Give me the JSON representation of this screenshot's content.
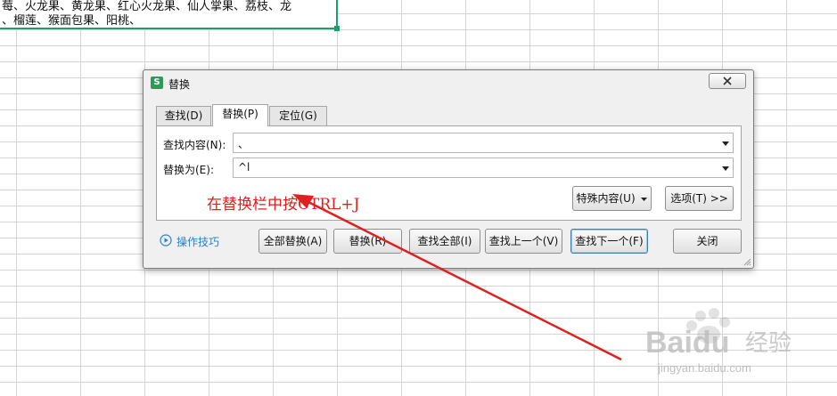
{
  "sheet": {
    "cell_lines": [
      "莓、火龙果、黄龙果、红心火龙果、仙人掌果、荔枝、龙",
      "、榴莲、猴面包果、阳桃、"
    ]
  },
  "dialog": {
    "title": "替换",
    "app_icon": "S",
    "tabs": [
      {
        "label": "查找(D)"
      },
      {
        "label": "替换(P)",
        "active": true
      },
      {
        "label": "定位(G)"
      }
    ],
    "find_label": "查找内容(N):",
    "find_value": "、",
    "replace_label": "替换为(E):",
    "replace_value": "^l",
    "special_button": "特殊内容(U)",
    "options_button": "选项(T) >>",
    "tips_link": "操作技巧",
    "buttons": {
      "replace_all": "全部替换(A)",
      "replace": "替换(R)",
      "find_all": "查找全部(I)",
      "find_prev": "查找上一个(V)",
      "find_next": "查找下一个(F)",
      "close": "关闭"
    }
  },
  "annotation": {
    "text": "在替换栏中按CTRL+J",
    "color": "#e02020"
  },
  "watermark": {
    "brand": "Bai",
    "brand_tail": "du",
    "brand_cn": "经验",
    "url": "jingyan.baidu.com"
  },
  "colors": {
    "selection": "#1e9e6c",
    "link": "#2b7fc8",
    "app_icon": "#2c9a58"
  }
}
